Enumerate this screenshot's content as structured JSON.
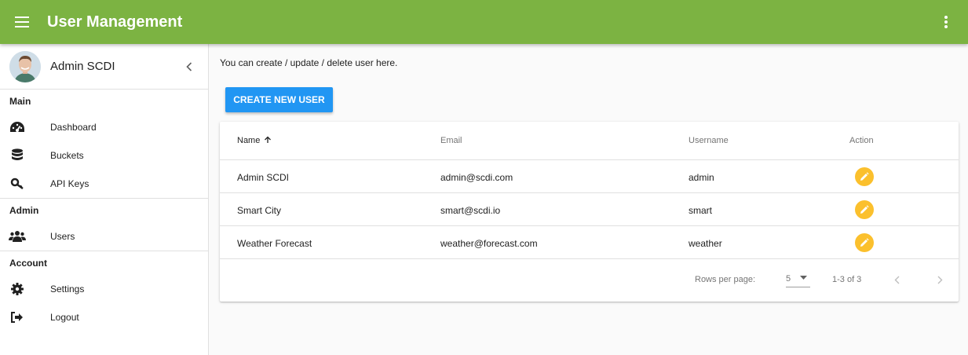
{
  "appbar": {
    "title": "User Management",
    "color": "#7cb342",
    "menu_icon": "menu-icon",
    "more_icon": "more-vert-icon"
  },
  "drawer": {
    "profile": {
      "name": "Admin SCDI",
      "collapse_icon": "chevron-left-icon"
    },
    "sections": [
      {
        "title": "Main",
        "items": [
          {
            "label": "Dashboard",
            "icon": "dashboard-icon"
          },
          {
            "label": "Buckets",
            "icon": "database-icon"
          },
          {
            "label": "API Keys",
            "icon": "key-icon"
          }
        ]
      },
      {
        "title": "Admin",
        "items": [
          {
            "label": "Users",
            "icon": "users-icon"
          }
        ]
      },
      {
        "title": "Account",
        "items": [
          {
            "label": "Settings",
            "icon": "gear-icon"
          },
          {
            "label": "Logout",
            "icon": "logout-icon"
          }
        ]
      }
    ]
  },
  "main": {
    "intro": "You can create / update / delete user here.",
    "create_button": "CREATE NEW USER",
    "table": {
      "columns": [
        "Name",
        "Email",
        "Username",
        "Action"
      ],
      "sort_icon": "arrow-up-icon",
      "rows": [
        {
          "name": "Admin SCDI",
          "email": "admin@scdi.com",
          "username": "admin"
        },
        {
          "name": "Smart City",
          "email": "smart@scdi.io",
          "username": "smart"
        },
        {
          "name": "Weather Forecast",
          "email": "weather@forecast.com",
          "username": "weather"
        }
      ],
      "edit_icon": "pencil-icon"
    },
    "pagination": {
      "rows_per_page_label": "Rows per page:",
      "rows_per_page": "5",
      "range": "1-3 of 3"
    }
  },
  "colors": {
    "accent": "#2196f3",
    "edit": "#fbc02d"
  }
}
